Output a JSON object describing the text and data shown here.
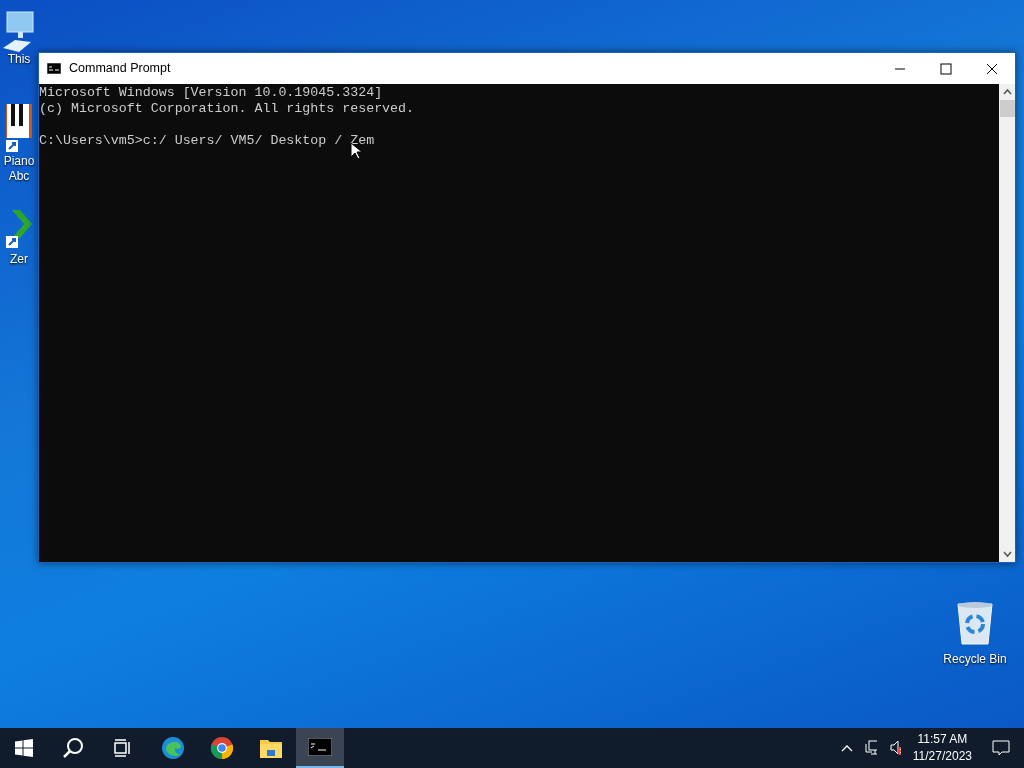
{
  "desktop_icons": [
    {
      "kind": "computer",
      "lines": [
        "This"
      ]
    },
    {
      "kind": "piano",
      "lines": [
        "Piano",
        "Abc"
      ]
    },
    {
      "kind": "zem",
      "lines": [
        "Zer"
      ]
    }
  ],
  "recycle_bin": {
    "label": "Recycle Bin"
  },
  "window": {
    "title": "Command Prompt",
    "lines": [
      "Microsoft Windows [Version 10.0.19045.3324]",
      "(c) Microsoft Corporation. All rights reserved."
    ],
    "command_line": "C:\\Users\\vm5>c:/ Users/ VM5/ Desktop / Zem"
  },
  "taskbar": {
    "apps": [
      {
        "kind": "start",
        "selected": false
      },
      {
        "kind": "search",
        "selected": false
      },
      {
        "kind": "taskview",
        "selected": false
      },
      {
        "kind": "edge",
        "selected": false
      },
      {
        "kind": "chrome",
        "selected": false
      },
      {
        "kind": "explorer",
        "selected": false
      },
      {
        "kind": "cmd",
        "selected": true
      }
    ],
    "volume_muted": true,
    "time": "11:57 AM",
    "date": "11/27/2023"
  }
}
